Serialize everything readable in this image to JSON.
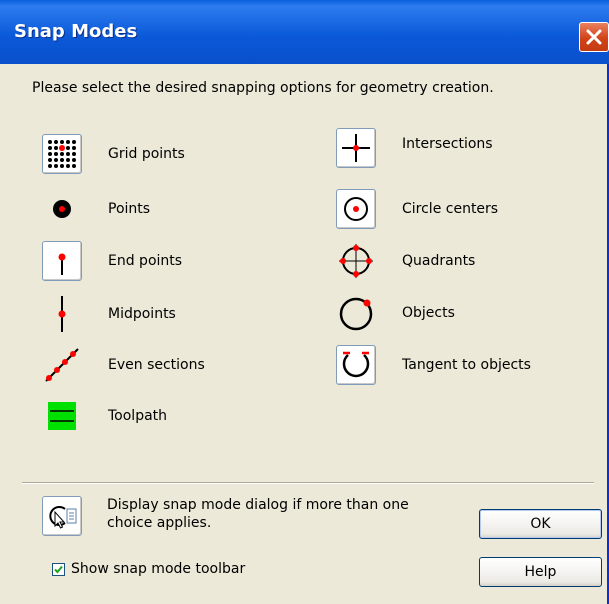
{
  "window": {
    "title": "Snap Modes"
  },
  "instruction": "Please select the desired snapping options for geometry creation.",
  "left_options": [
    {
      "label": "Grid points",
      "icon": "grid-points-icon"
    },
    {
      "label": "Points",
      "icon": "point-icon"
    },
    {
      "label": "End points",
      "icon": "end-points-icon"
    },
    {
      "label": "Midpoints",
      "icon": "midpoints-icon"
    },
    {
      "label": "Even sections",
      "icon": "even-sections-icon"
    },
    {
      "label": "Toolpath",
      "icon": "toolpath-icon"
    }
  ],
  "right_options": [
    {
      "label": "Intersections",
      "icon": "intersections-icon"
    },
    {
      "label": "Circle centers",
      "icon": "circle-centers-icon"
    },
    {
      "label": "Quadrants",
      "icon": "quadrants-icon"
    },
    {
      "label": "Objects",
      "icon": "objects-icon"
    },
    {
      "label": "Tangent to objects",
      "icon": "tangent-icon"
    }
  ],
  "dialog_option": {
    "line1": "Display snap mode dialog if more than one",
    "line2": "choice applies."
  },
  "checkbox": {
    "label": "Show snap mode toolbar",
    "checked": true
  },
  "buttons": {
    "ok": "OK",
    "help": "Help"
  },
  "colors": {
    "snap_point": "#ff0000",
    "toolpath": "#00e000",
    "title_bar": "#0a5fdc",
    "close_button": "#d2431a"
  }
}
